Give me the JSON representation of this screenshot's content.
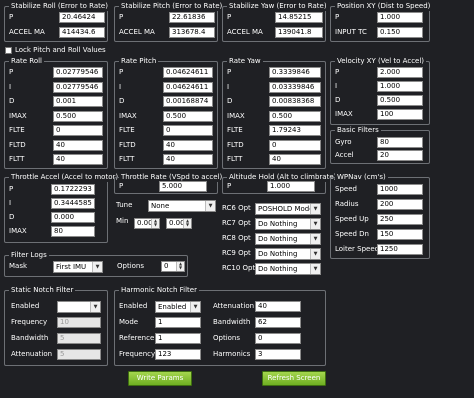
{
  "stab_roll": {
    "title": "Stabilize Roll (Error to Rate)",
    "p_label": "P",
    "p": "20.46424",
    "accel_label": "ACCEL MA",
    "accel": "414434.6"
  },
  "stab_pitch": {
    "title": "Stabilize Pitch (Error to Rate)",
    "p_label": "P",
    "p": "22.61836",
    "accel_label": "ACCEL MA",
    "accel": "313678.4"
  },
  "stab_yaw": {
    "title": "Stabilize Yaw (Error to Rate)",
    "p_label": "P",
    "p": "14.85215",
    "accel_label": "ACCEL MA",
    "accel": "139041.8"
  },
  "pos_xy": {
    "title": "Position XY (Dist to Speed)",
    "p_label": "P",
    "p": "1.000",
    "tc_label": "INPUT TC",
    "tc": "0.150"
  },
  "lock_label": "Lock Pitch and Roll Values",
  "rate_roll": {
    "title": "Rate Roll",
    "rows": [
      {
        "label": "P",
        "value": "0.02779546"
      },
      {
        "label": "I",
        "value": "0.02779546"
      },
      {
        "label": "D",
        "value": "0.001"
      },
      {
        "label": "IMAX",
        "value": "0.500"
      },
      {
        "label": "FLTE",
        "value": "0"
      },
      {
        "label": "FLTD",
        "value": "40"
      },
      {
        "label": "FLTT",
        "value": "40"
      }
    ]
  },
  "rate_pitch": {
    "title": "Rate Pitch",
    "rows": [
      {
        "label": "P",
        "value": "0.04624611"
      },
      {
        "label": "I",
        "value": "0.04624611"
      },
      {
        "label": "D",
        "value": "0.00168874"
      },
      {
        "label": "IMAX",
        "value": "0.500"
      },
      {
        "label": "FLTE",
        "value": "0"
      },
      {
        "label": "FLTD",
        "value": "40"
      },
      {
        "label": "FLTT",
        "value": "40"
      }
    ]
  },
  "rate_yaw": {
    "title": "Rate Yaw",
    "rows": [
      {
        "label": "P",
        "value": "0.3339846"
      },
      {
        "label": "I",
        "value": "0.03339846"
      },
      {
        "label": "D",
        "value": "0.00838368"
      },
      {
        "label": "IMAX",
        "value": "0.500"
      },
      {
        "label": "FLTE",
        "value": "1.79243"
      },
      {
        "label": "FLTD",
        "value": "0"
      },
      {
        "label": "FLTT",
        "value": "40"
      }
    ]
  },
  "vel_xy": {
    "title": "Velocity XY (Vel to Accel)",
    "rows": [
      {
        "label": "P",
        "value": "2.000"
      },
      {
        "label": "I",
        "value": "1.000"
      },
      {
        "label": "D",
        "value": "0.500"
      },
      {
        "label": "IMAX",
        "value": "100"
      }
    ]
  },
  "basic_filters": {
    "title": "Basic Filters",
    "rows": [
      {
        "label": "Gyro",
        "value": "80"
      },
      {
        "label": "Accel",
        "value": "20"
      }
    ]
  },
  "throttle_accel": {
    "title": "Throttle Accel (Accel to motor)",
    "rows": [
      {
        "label": "P",
        "value": "0.1722293"
      },
      {
        "label": "I",
        "value": "0.3444585"
      },
      {
        "label": "D",
        "value": "0.000"
      },
      {
        "label": "IMAX",
        "value": "80"
      }
    ]
  },
  "throttle_rate": {
    "title": "Throttle Rate (VSpd to accel)",
    "p_label": "P",
    "p": "5.000"
  },
  "tune": {
    "label": "Tune",
    "value": "None",
    "min_label": "Min",
    "min": "0.000",
    "max": "0.000"
  },
  "alt_hold": {
    "title": "Altitude Hold (Alt to climbrate)",
    "p_label": "P",
    "p": "1.000"
  },
  "rc_opts": [
    {
      "label": "RC6 Opt",
      "value": "POSHOLD Mode"
    },
    {
      "label": "RC7 Opt",
      "value": "Do Nothing"
    },
    {
      "label": "RC8 Opt",
      "value": "Do Nothing"
    },
    {
      "label": "RC9 Opt",
      "value": "Do Nothing"
    },
    {
      "label": "RC10 Opt",
      "value": "Do Nothing"
    }
  ],
  "wpnav": {
    "title": "WPNav (cm's)",
    "rows": [
      {
        "label": "Speed",
        "value": "1000"
      },
      {
        "label": "Radius",
        "value": "200"
      },
      {
        "label": "Speed Up",
        "value": "250"
      },
      {
        "label": "Speed Dn",
        "value": "150"
      },
      {
        "label": "Loiter Speed",
        "value": "1250"
      }
    ]
  },
  "filter_logs": {
    "title": "Filter Logs",
    "mask_label": "Mask",
    "mask": "First IMU",
    "options_label": "Options",
    "options": "0"
  },
  "static_notch": {
    "title": "Static Notch Filter",
    "enabled_label": "Enabled",
    "enabled": "",
    "freq_label": "Frequency",
    "freq": "10",
    "bw_label": "Bandwidth",
    "bw": "5",
    "att_label": "Attenuation",
    "att": "5"
  },
  "harmonic_notch": {
    "title": "Harmonic Notch Filter",
    "left": [
      {
        "label": "Enabled",
        "value": "Enabled"
      },
      {
        "label": "Mode",
        "value": "1"
      },
      {
        "label": "Reference",
        "value": "1"
      },
      {
        "label": "Frequency",
        "value": "123"
      }
    ],
    "right": [
      {
        "label": "Attenuation",
        "value": "40"
      },
      {
        "label": "Bandwidth",
        "value": "62"
      },
      {
        "label": "Options",
        "value": "0"
      },
      {
        "label": "Harmonics",
        "value": "3"
      }
    ]
  },
  "buttons": {
    "write": "Write Params",
    "refresh": "Refresh Screen"
  }
}
